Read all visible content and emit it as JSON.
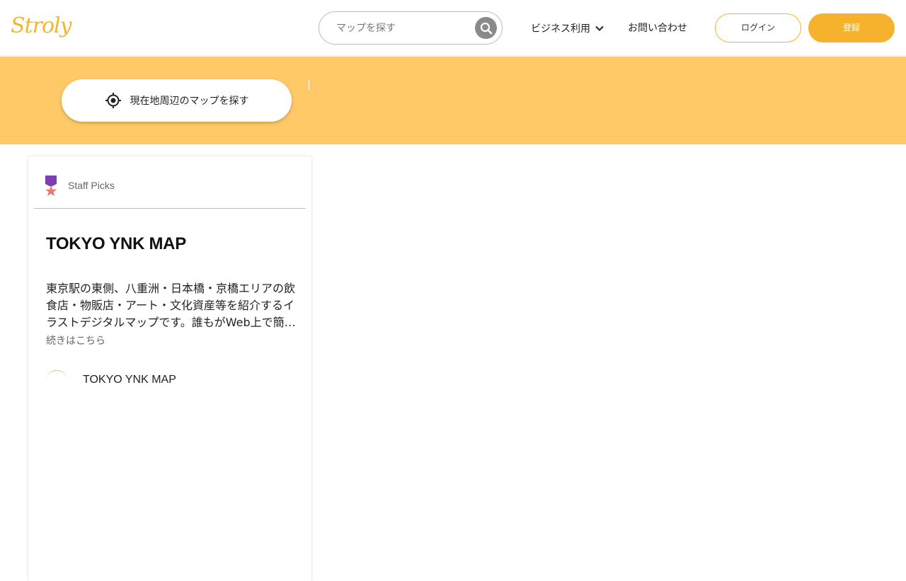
{
  "header": {
    "logo_text": "Stroly",
    "brand_color": "#f7b52b",
    "search": {
      "placeholder": "マップを探す",
      "icon": "search-icon"
    },
    "nav": {
      "business_label": "ビジネス利用",
      "contact_label": "お問い合わせ"
    },
    "buttons": {
      "login_label": "ログイン",
      "register_label": "登録"
    }
  },
  "banner": {
    "background": "#fec966",
    "locate_label": "現在地周辺のマップを探す",
    "locate_icon": "crosshair-target-icon"
  },
  "card": {
    "section_label": "Staff Picks",
    "section_icon": "ribbon-star-badge-icon",
    "title": "TOKYO YNK MAP",
    "description": "東京駅の東側、八重洲・日本橋・京橋エリアの飲食店・物販店・アート・文化資産等を紹介するイラストデジタルマップです。誰もがWeb上で簡単に",
    "read_more": "続きはこちら",
    "map_name": "TOKYO YNK MAP"
  }
}
